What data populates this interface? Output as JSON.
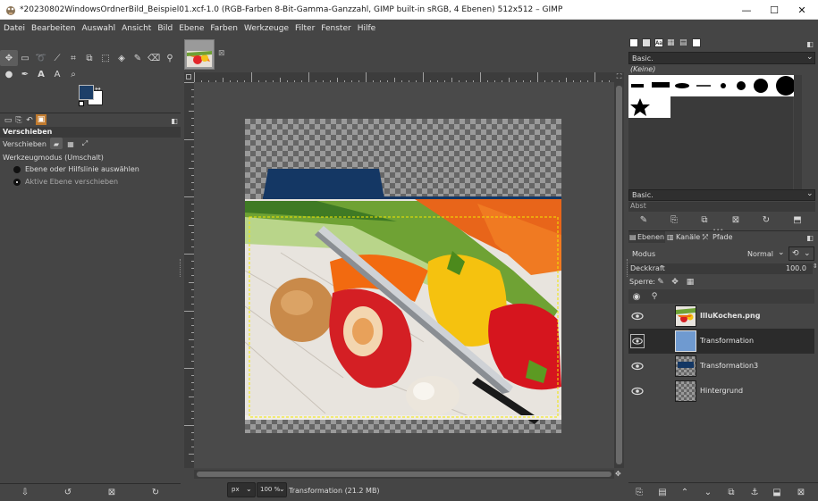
{
  "window": {
    "title": "*20230802WindowsOrdnerBild_Beispiel01.xcf-1.0 (RGB-Farben 8-Bit-Gamma-Ganzzahl, GIMP built-in sRGB, 4 Ebenen) 512x512 – GIMP",
    "minimize": "—",
    "maximize": "☐",
    "close": "✕"
  },
  "menu": [
    "Datei",
    "Bearbeiten",
    "Auswahl",
    "Ansicht",
    "Bild",
    "Ebene",
    "Farben",
    "Werkzeuge",
    "Filter",
    "Fenster",
    "Hilfe"
  ],
  "toolbox": {
    "tool_options_title": "Verschieben",
    "move_label": "Verschieben",
    "mode_label": "Werkzeugmodus (Umschalt)",
    "option1": "Ebene oder Hilfslinie auswählen",
    "option2": "Aktive Ebene verschieben",
    "fg_color": "#1d3f68",
    "bg_color": "#ffffff"
  },
  "brushes": {
    "filter_value": "Basic.",
    "current_brush": "(Keine)",
    "tag_value": "Basic.",
    "spacing_label": "Abst"
  },
  "layers_panel": {
    "tabs": [
      "Ebenen",
      "Kanäle",
      "Pfade"
    ],
    "mode_label": "Modus",
    "mode_value": "Normal",
    "opacity_label": "Deckkraft",
    "opacity_value": "100.0",
    "lock_label": "Sperre:",
    "layers": [
      {
        "name": "IlluKochen.png",
        "bold": true
      },
      {
        "name": "Transformation",
        "bold": false
      },
      {
        "name": "Transformation3",
        "bold": false
      },
      {
        "name": "Hintergrund",
        "bold": false
      }
    ]
  },
  "status": {
    "unit": "px",
    "zoom": "100 %",
    "message": "Transformation (21.2 MB)"
  },
  "colors": {
    "accent": "#1d3f68",
    "selected_row": "#2b2b2b",
    "panel_bg": "#454545"
  }
}
